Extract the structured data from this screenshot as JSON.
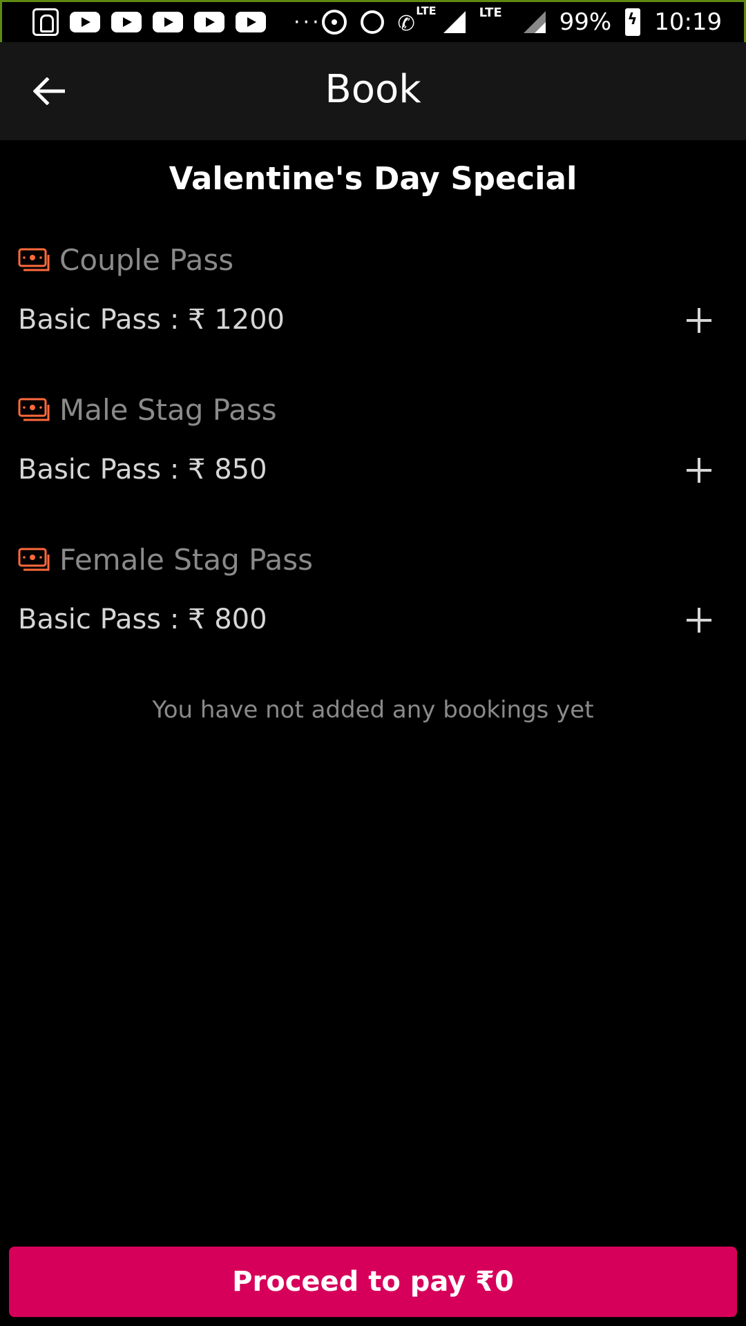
{
  "status_bar": {
    "battery": "99%",
    "time": "10:19",
    "network_label": "LTE",
    "call_label": "LTE"
  },
  "app_bar": {
    "title": "Book",
    "back_icon": "arrow-left-icon"
  },
  "event": {
    "title": "Valentine's Day Special"
  },
  "sections": [
    {
      "name": "Couple Pass",
      "price_label": "Basic Pass : ₹ 1200"
    },
    {
      "name": "Male Stag Pass",
      "price_label": "Basic Pass : ₹ 850"
    },
    {
      "name": "Female Stag Pass",
      "price_label": "Basic Pass : ₹ 800"
    }
  ],
  "bookings": {
    "empty_message": "You have not added any bookings yet"
  },
  "pay_button": {
    "label": "Proceed to pay ₹0"
  },
  "colors": {
    "accent": "#d6005a",
    "ticket_icon": "#ff6a3d",
    "status_border": "#5f8a12"
  }
}
